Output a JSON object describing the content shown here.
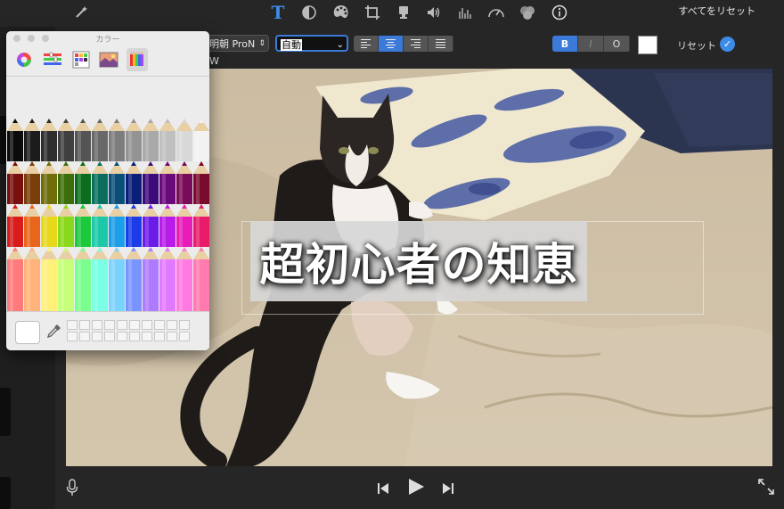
{
  "toolbar": {
    "icons": [
      "magic-wand-icon",
      "title-icon",
      "color-balance-icon",
      "palette-icon",
      "crop-icon",
      "stabilization-icon",
      "volume-icon",
      "equalizer-icon",
      "speed-icon",
      "filter-icon",
      "info-icon"
    ],
    "reset_all_label": "すべてをリセット",
    "accent_color": "#3c7ad9"
  },
  "format_bar": {
    "font_value": "明朝 ProN W",
    "size_value": "自動",
    "alignments": [
      "left",
      "center",
      "right",
      "justify"
    ],
    "selected_alignment": "center",
    "style_buttons": {
      "bold": "B",
      "italic": "I",
      "outline": "O"
    },
    "bold_selected": true,
    "text_color": "#ffffff",
    "reset_label": "リセット"
  },
  "viewer": {
    "title_text": "超初心者の知恵"
  },
  "color_panel": {
    "title": "カラー",
    "modes": [
      "color-wheel-icon",
      "sliders-icon",
      "palettes-icon",
      "image-palette-icon",
      "pencils-icon"
    ],
    "selected_mode": "pencils-icon",
    "current_color": "#ffffff",
    "pencil_rows": [
      [
        "#0b0b0b",
        "#1c1c1c",
        "#2e2e2e",
        "#404040",
        "#545454",
        "#686868",
        "#7d7d7d",
        "#939393",
        "#a9a9a9",
        "#c0c0c0",
        "#d8d8d8",
        "#f2f2f2"
      ],
      [
        "#7a0f0f",
        "#7a3e0a",
        "#6e6e0a",
        "#3e6e0a",
        "#0a6e1e",
        "#0a6e5e",
        "#0a4e7a",
        "#0a1e7a",
        "#3c0a7a",
        "#6a0a7a",
        "#7a0a5a",
        "#7a0a2e"
      ],
      [
        "#d81c1c",
        "#e8661c",
        "#e8d81c",
        "#8ad81c",
        "#1cc83c",
        "#1cc8a8",
        "#1c9ee8",
        "#1c3ce8",
        "#6c1ce8",
        "#b81ce8",
        "#e81cb8",
        "#e81c6a"
      ],
      [
        "#ff7a7a",
        "#ffb27a",
        "#fff07a",
        "#c6ff7a",
        "#7aff8e",
        "#7affe4",
        "#7ad2ff",
        "#7a94ff",
        "#ae7aff",
        "#e27aff",
        "#ff7ae2",
        "#ff7aae"
      ]
    ]
  }
}
